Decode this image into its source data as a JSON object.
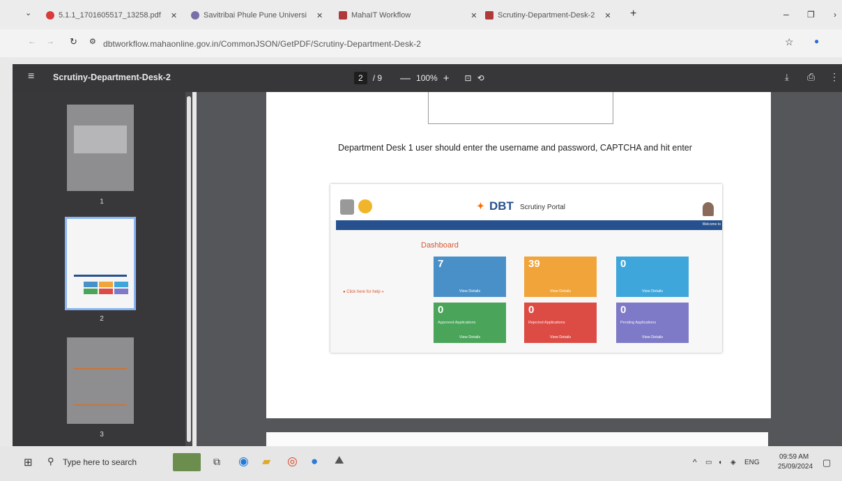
{
  "browser": {
    "tabs": [
      {
        "label": "5.1.1_1701605517_13258.pdf",
        "favicon": "pdf-icon"
      },
      {
        "label": "Savitribai Phule Pune Universi",
        "favicon": "university-icon"
      },
      {
        "label": "MahaIT Workflow",
        "favicon": "dbt-icon"
      },
      {
        "label": "Scrutiny-Department-Desk-2",
        "favicon": "dbt-icon"
      }
    ],
    "url": "dbtworkflow.mahaonline.gov.in/CommonJSON/GetPDF/Scrutiny-Department-Desk-2"
  },
  "pdf": {
    "title": "Scrutiny-Department-Desk-2",
    "current_page": "2",
    "total_pages": "/ 9",
    "zoom": "100%",
    "thumbnails": [
      "1",
      "2",
      "3"
    ]
  },
  "page_content": {
    "caption": "Department Desk 1 user should enter the username and password, CAPTCHA and hit enter"
  },
  "screenshot": {
    "portal_title": "Scrutiny Portal",
    "brand": "DBT",
    "welcome": "Welcome to",
    "dashboard_title": "Dashboard",
    "help_link": "Click here for help",
    "tiles": [
      {
        "value": "7",
        "view": "View Details",
        "color": "#4a90c8"
      },
      {
        "value": "39",
        "view": "View Details",
        "color": "#f0a43a"
      },
      {
        "value": "0",
        "view": "View Details",
        "color": "#3ea6da"
      },
      {
        "value": "0",
        "label": "Approved Applications",
        "view": "View Details",
        "color": "#4aa45a"
      },
      {
        "value": "0",
        "label": "Rejected Applications",
        "view": "View Details",
        "color": "#dd4b45"
      },
      {
        "value": "0",
        "label": "Pending Applications",
        "view": "View Details",
        "color": "#7f7ac8"
      }
    ]
  },
  "taskbar": {
    "search_placeholder": "Type here to search",
    "lang": "ENG",
    "time": "09:59 AM",
    "date": "25/09/2024"
  }
}
